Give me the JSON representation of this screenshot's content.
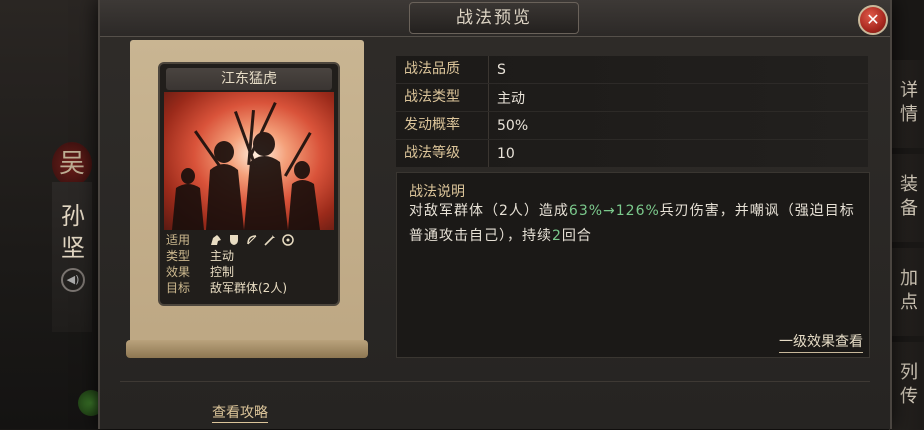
{
  "background": {
    "faction_char": "吴",
    "hero_name_chars": [
      "孙",
      "坚"
    ],
    "side_tabs": [
      "详情",
      "装备",
      "加点",
      "列传"
    ]
  },
  "dialog": {
    "title": "战法预览",
    "close_label": "✕"
  },
  "card": {
    "name": "江东猛虎",
    "rows": [
      {
        "key": "适用",
        "icons": [
          "cavalry-icon",
          "shield-icon",
          "bow-icon",
          "spear-icon",
          "wheel-icon"
        ]
      },
      {
        "key": "类型",
        "value": "主动"
      },
      {
        "key": "效果",
        "value": "控制"
      },
      {
        "key": "目标",
        "value": "敌军群体(2人)"
      }
    ]
  },
  "attributes": [
    {
      "key": "战法品质",
      "value": "S"
    },
    {
      "key": "战法类型",
      "value": "主动"
    },
    {
      "key": "发动概率",
      "value": "50%"
    },
    {
      "key": "战法等级",
      "value": "10"
    }
  ],
  "description": {
    "title": "战法说明",
    "part1": "对敌军群体（2人）造成",
    "range": "63%→126%",
    "part2": "兵刃伤害，并嘲讽（强迫目标普通攻击自己），持续",
    "rounds": "2",
    "part3": "回合",
    "level_effect_link": "一级效果查看"
  },
  "footer": {
    "guide_link": "查看攻略"
  },
  "colors": {
    "accent_gold": "#dcc59a",
    "highlight_green": "#7bc98c",
    "close_red": "#a8281f"
  }
}
